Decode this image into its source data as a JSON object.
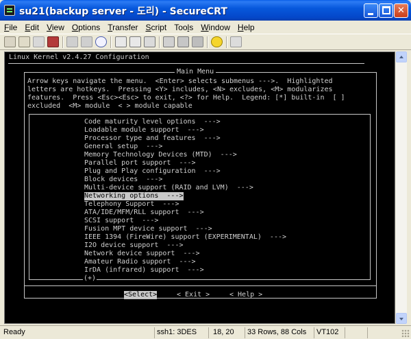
{
  "window": {
    "title": "su21(backup server - 도리) - SecureCRT"
  },
  "menu": [
    "File",
    "Edit",
    "View",
    "Options",
    "Transfer",
    "Script",
    "Tools",
    "Window",
    "Help"
  ],
  "menu_underline": [
    "F",
    "E",
    "V",
    "O",
    "T",
    "S",
    "l",
    "W",
    "H"
  ],
  "terminal": {
    "header": "Linux Kernel v2.4.27 Configuration",
    "menu_title": "Main Menu",
    "help_lines": [
      "Arrow keys navigate the menu.  <Enter> selects submenus --->.  Highlighted",
      "letters are hotkeys.  Pressing <Y> includes, <N> excludes, <M> modularizes",
      "features.  Press <Esc><Esc> to exit, <?> for Help.  Legend: [*] built-in  [ ]",
      "excluded  <M> module  < > module capable"
    ],
    "items": [
      "Code maturity level options  --->",
      "Loadable module support  --->",
      "Processor type and features  --->",
      "General setup  --->",
      "Memory Technology Devices (MTD)  --->",
      "Parallel port support  --->",
      "Plug and Play configuration  --->",
      "Block devices  --->",
      "Multi-device support (RAID and LVM)  --->",
      "Networking options  --->",
      "Telephony Support  --->",
      "ATA/IDE/MFM/RLL support  --->",
      "SCSI support  --->",
      "Fusion MPT device support  --->",
      "IEEE 1394 (FireWire) support (EXPERIMENTAL)  --->",
      "I2O device support  --->",
      "Network device support  --->",
      "Amateur Radio support  --->",
      "IrDA (infrared) support  --->"
    ],
    "selected_index": 9,
    "more_indicator": "(+)",
    "buttons": {
      "select": "<Select>",
      "exit": "< Exit >",
      "help": "< Help >"
    }
  },
  "status": {
    "ready": "Ready",
    "protocol": "ssh1: 3DES",
    "cursor": "18, 20",
    "size": "33 Rows, 88 Cols",
    "terminal_type": "VT102"
  },
  "colors": {
    "title_bar": "#0A5FE8",
    "terminal_bg": "#000000",
    "terminal_fg": "#D0D0D0",
    "highlight_bg": "#C8C8C8"
  }
}
